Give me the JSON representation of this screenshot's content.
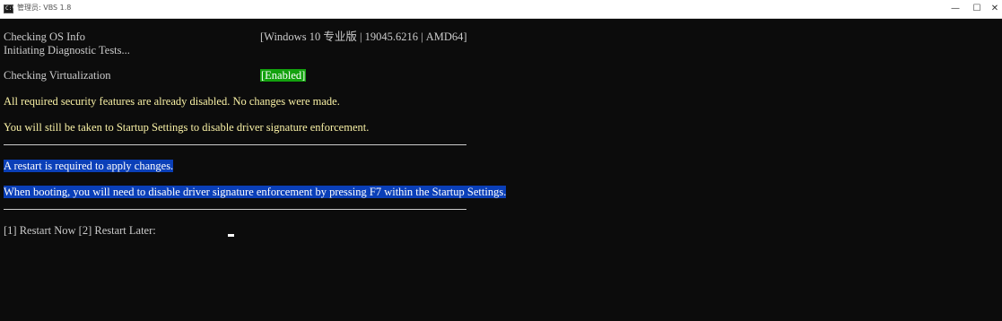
{
  "window": {
    "title": "管理员: VBS 1.8",
    "minimize": "—",
    "maximize": "☐",
    "close": "✕"
  },
  "terminal": {
    "os_label": "Checking OS Info",
    "os_value": "[Windows 10 专业版 | 19045.6216 | AMD64]",
    "diag": "Initiating Diagnostic Tests...",
    "virt_label": "Checking Virtualization",
    "virt_value": "[Enabled]",
    "msg_security": "All required security features are already disabled. No changes were made.",
    "msg_startup": "You will still be taken to Startup Settings to disable driver signature enforcement.",
    "msg_restart": "A restart is required to apply changes.",
    "msg_booting": "When booting, you will need to disable driver signature enforcement by pressing F7 within the Startup Settings.",
    "prompt": "[1] Restart Now [2] Restart Later: "
  },
  "colors": {
    "background": "#0c0c0c",
    "text": "#cccccc",
    "warning": "#f9f1a5",
    "enabled_bg": "#13a10e",
    "selection_bg": "#0a3fb8"
  }
}
